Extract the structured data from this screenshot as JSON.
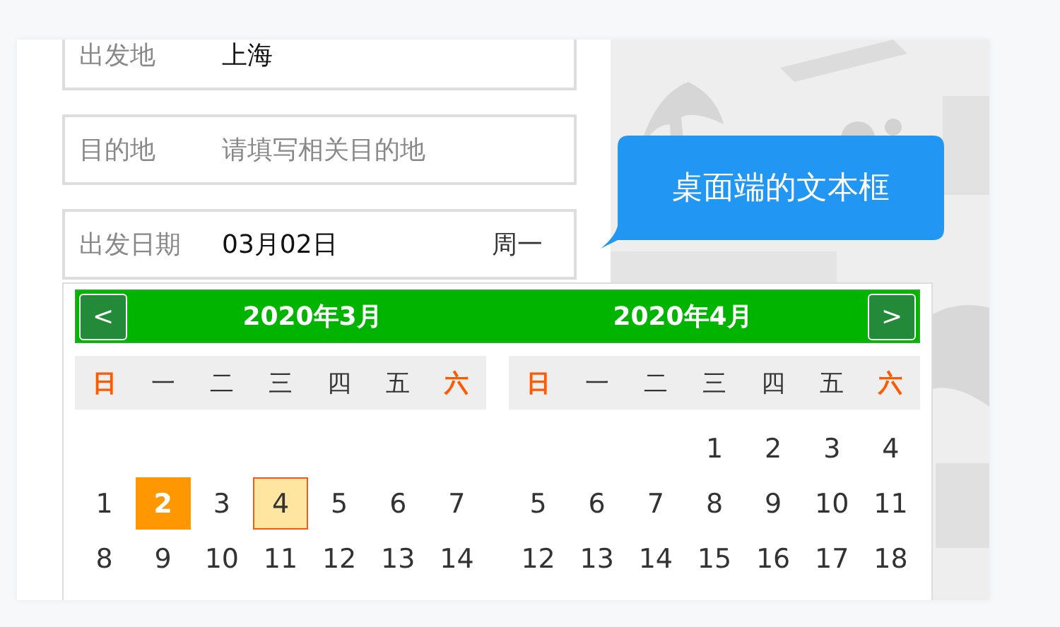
{
  "form": {
    "fields": [
      {
        "label": "出发地",
        "value": "上海"
      },
      {
        "label": "目的地",
        "placeholder": "请填写相关目的地"
      },
      {
        "label": "出发日期",
        "value": "03月02日",
        "weekday": "周一"
      }
    ]
  },
  "tooltip": {
    "text": "桌面端的文本框"
  },
  "calendar": {
    "prev": "<",
    "next": ">",
    "months": [
      {
        "title": "2020年3月",
        "weekdays": [
          {
            "text": "日",
            "weekend": true
          },
          {
            "text": "一",
            "weekend": false
          },
          {
            "text": "二",
            "weekend": false
          },
          {
            "text": "三",
            "weekend": false
          },
          {
            "text": "四",
            "weekend": false
          },
          {
            "text": "五",
            "weekend": false
          },
          {
            "text": "六",
            "weekend": true
          }
        ],
        "weeks": [
          [
            {
              "kind": "blank"
            },
            {
              "kind": "blank"
            },
            {
              "kind": "blank"
            },
            {
              "kind": "blank"
            },
            {
              "kind": "blank"
            },
            {
              "kind": "blank"
            },
            {
              "kind": "blank"
            }
          ],
          [
            {
              "kind": "day",
              "text": "1",
              "selected": false,
              "hovered": false
            },
            {
              "kind": "day",
              "text": "2",
              "selected": true,
              "hovered": false
            },
            {
              "kind": "day",
              "text": "3",
              "selected": false,
              "hovered": false
            },
            {
              "kind": "day",
              "text": "4",
              "selected": false,
              "hovered": true
            },
            {
              "kind": "day",
              "text": "5",
              "selected": false,
              "hovered": false
            },
            {
              "kind": "day",
              "text": "6",
              "selected": false,
              "hovered": false
            },
            {
              "kind": "day",
              "text": "7",
              "selected": false,
              "hovered": false
            }
          ],
          [
            {
              "kind": "day",
              "text": "8",
              "selected": false,
              "hovered": false
            },
            {
              "kind": "day",
              "text": "9",
              "selected": false,
              "hovered": false
            },
            {
              "kind": "day",
              "text": "10",
              "selected": false,
              "hovered": false
            },
            {
              "kind": "day",
              "text": "11",
              "selected": false,
              "hovered": false
            },
            {
              "kind": "day",
              "text": "12",
              "selected": false,
              "hovered": false
            },
            {
              "kind": "day",
              "text": "13",
              "selected": false,
              "hovered": false
            },
            {
              "kind": "day",
              "text": "14",
              "selected": false,
              "hovered": false
            }
          ]
        ]
      },
      {
        "title": "2020年4月",
        "weekdays": [
          {
            "text": "日",
            "weekend": true
          },
          {
            "text": "一",
            "weekend": false
          },
          {
            "text": "二",
            "weekend": false
          },
          {
            "text": "三",
            "weekend": false
          },
          {
            "text": "四",
            "weekend": false
          },
          {
            "text": "五",
            "weekend": false
          },
          {
            "text": "六",
            "weekend": true
          }
        ],
        "weeks": [
          [
            {
              "kind": "blank"
            },
            {
              "kind": "blank"
            },
            {
              "kind": "blank"
            },
            {
              "kind": "day",
              "text": "1",
              "selected": false,
              "hovered": false
            },
            {
              "kind": "day",
              "text": "2",
              "selected": false,
              "hovered": false
            },
            {
              "kind": "day",
              "text": "3",
              "selected": false,
              "hovered": false
            },
            {
              "kind": "day",
              "text": "4",
              "selected": false,
              "hovered": false
            }
          ],
          [
            {
              "kind": "day",
              "text": "5",
              "selected": false,
              "hovered": false
            },
            {
              "kind": "day",
              "text": "6",
              "selected": false,
              "hovered": false
            },
            {
              "kind": "day",
              "text": "7",
              "selected": false,
              "hovered": false
            },
            {
              "kind": "day",
              "text": "8",
              "selected": false,
              "hovered": false
            },
            {
              "kind": "day",
              "text": "9",
              "selected": false,
              "hovered": false
            },
            {
              "kind": "day",
              "text": "10",
              "selected": false,
              "hovered": false
            },
            {
              "kind": "day",
              "text": "11",
              "selected": false,
              "hovered": false
            }
          ],
          [
            {
              "kind": "day",
              "text": "12",
              "selected": false,
              "hovered": false
            },
            {
              "kind": "day",
              "text": "13",
              "selected": false,
              "hovered": false
            },
            {
              "kind": "day",
              "text": "14",
              "selected": false,
              "hovered": false
            },
            {
              "kind": "day",
              "text": "15",
              "selected": false,
              "hovered": false
            },
            {
              "kind": "day",
              "text": "16",
              "selected": false,
              "hovered": false
            },
            {
              "kind": "day",
              "text": "17",
              "selected": false,
              "hovered": false
            },
            {
              "kind": "day",
              "text": "18",
              "selected": false,
              "hovered": false
            }
          ]
        ]
      }
    ]
  }
}
